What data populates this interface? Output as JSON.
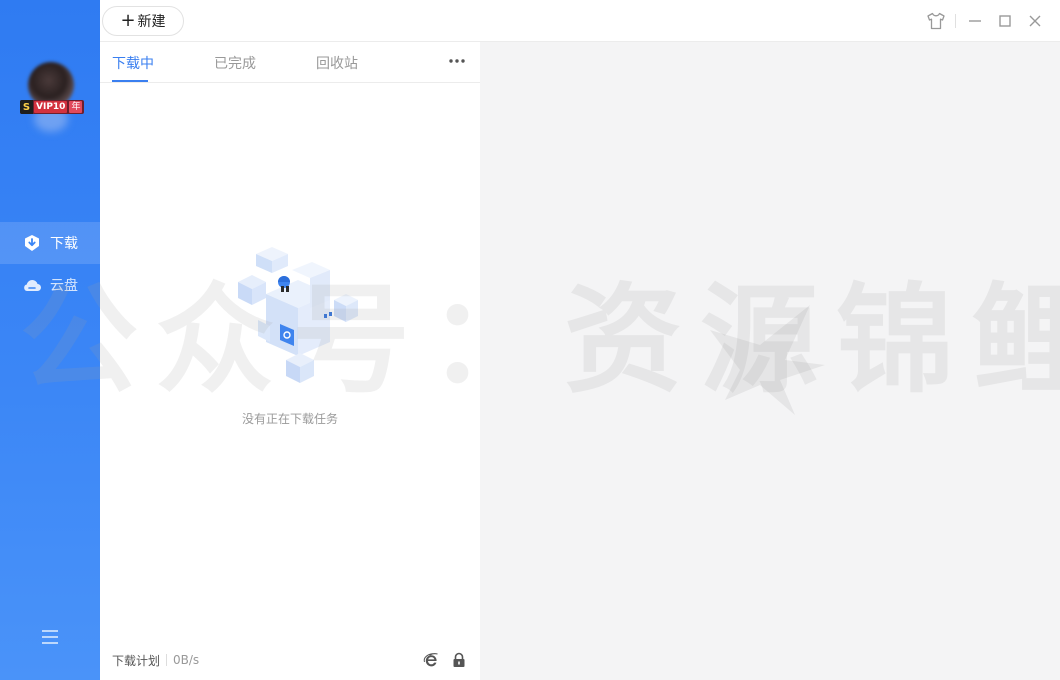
{
  "sidebar": {
    "vip": {
      "s": "S",
      "label": "VIP10",
      "year": "年"
    },
    "nav": [
      {
        "label": "下载",
        "icon": "download-shield-icon",
        "active": true
      },
      {
        "label": "云盘",
        "icon": "cloud-icon",
        "active": false
      }
    ],
    "menu_icon": "hamburger-icon"
  },
  "topbar": {
    "new_label": "新建",
    "controls": [
      "skin-icon",
      "minimize-icon",
      "maximize-icon",
      "close-icon"
    ]
  },
  "tabs": [
    {
      "label": "下载中",
      "active": true
    },
    {
      "label": "已完成",
      "active": false
    },
    {
      "label": "回收站",
      "active": false
    }
  ],
  "more_icon": "more-dots-icon",
  "empty": {
    "text": "没有正在下载任务"
  },
  "footer": {
    "plan_label": "下载计划",
    "speed": "0B/s",
    "icons": [
      "ie-icon",
      "lock-icon"
    ]
  },
  "watermark": {
    "text": "公众号：资源锦鲤"
  },
  "colors": {
    "sidebar": "#3b86f6",
    "accent": "#3a7ff0",
    "content_bg": "#f4f4f5"
  }
}
